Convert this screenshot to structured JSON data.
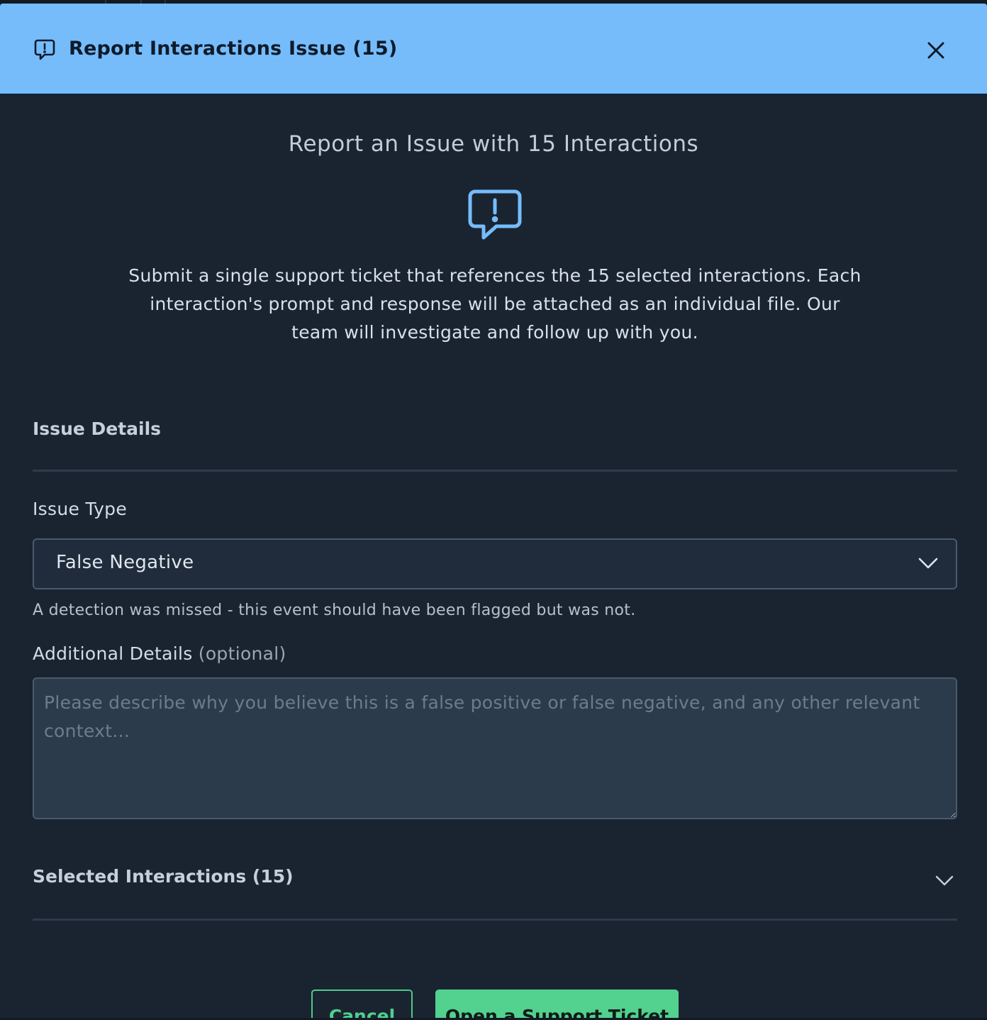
{
  "modal": {
    "title": "Report Interactions Issue (15)",
    "close_icon": "close-icon",
    "header_icon": "message-alert-icon"
  },
  "intro": {
    "subtitle": "Report an Issue with 15 Interactions",
    "icon": "message-alert-icon",
    "description": "Submit a single support ticket that references the 15 selected interactions. Each interaction's prompt and response will be attached as an individual file. Our team will investigate and follow up with you."
  },
  "issue_details": {
    "section_title": "Issue Details",
    "issue_type_label": "Issue Type",
    "issue_type_value": "False Negative",
    "issue_type_help": "A detection was missed - this event should have been flagged but was not.",
    "additional_label": "Additional Details",
    "additional_optional": "(optional)",
    "additional_value": "",
    "additional_placeholder": "Please describe why you believe this is a false positive or false negative, and any other relevant context..."
  },
  "selected_interactions": {
    "title": "Selected Interactions (15)"
  },
  "actions": {
    "cancel_label": "Cancel",
    "submit_label": "Open a Support Ticket"
  },
  "colors": {
    "header_bg": "#76bcfb",
    "modal_bg": "#1a2431",
    "accent_green": "#52d18f",
    "icon_blue": "#76bcfb"
  }
}
